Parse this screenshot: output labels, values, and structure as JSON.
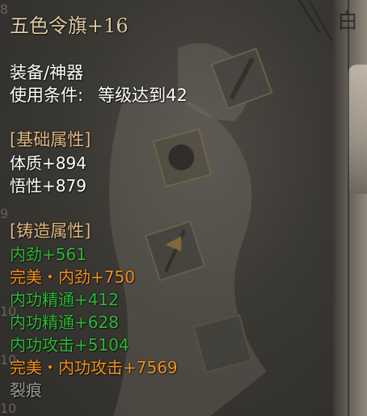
{
  "item": {
    "name": "五色令旗+16",
    "category": "装备/神器",
    "requirement_label": "使用条件:",
    "requirement_value": "等级达到42"
  },
  "sections": {
    "base_header": "[基础属性]",
    "base_stats": [
      {
        "text": "体质+894"
      },
      {
        "text": "悟性+879"
      }
    ],
    "forge_header": "[铸造属性]",
    "forge_stats": [
      {
        "text": "内劲+561",
        "quality": "green"
      },
      {
        "text": "完美・内劲+750",
        "quality": "orange"
      },
      {
        "text": "内功精通+412",
        "quality": "green"
      },
      {
        "text": "内功精通+628",
        "quality": "green"
      },
      {
        "text": "内功攻击+5104",
        "quality": "green"
      },
      {
        "text": "完美・内功攻击+7569",
        "quality": "orange"
      }
    ],
    "flaw": "裂痕"
  },
  "edge_numbers": [
    "8",
    "9",
    "10",
    "10",
    "10"
  ],
  "side_panel_glyph": "白",
  "colors": {
    "title": "#ddc9a2",
    "normal_text": "#ffffff",
    "section_header": "#e1b882",
    "green": "#2eb83a",
    "orange": "#f0901e",
    "flaw": "#9b9b9b",
    "background": "#3a3833"
  }
}
